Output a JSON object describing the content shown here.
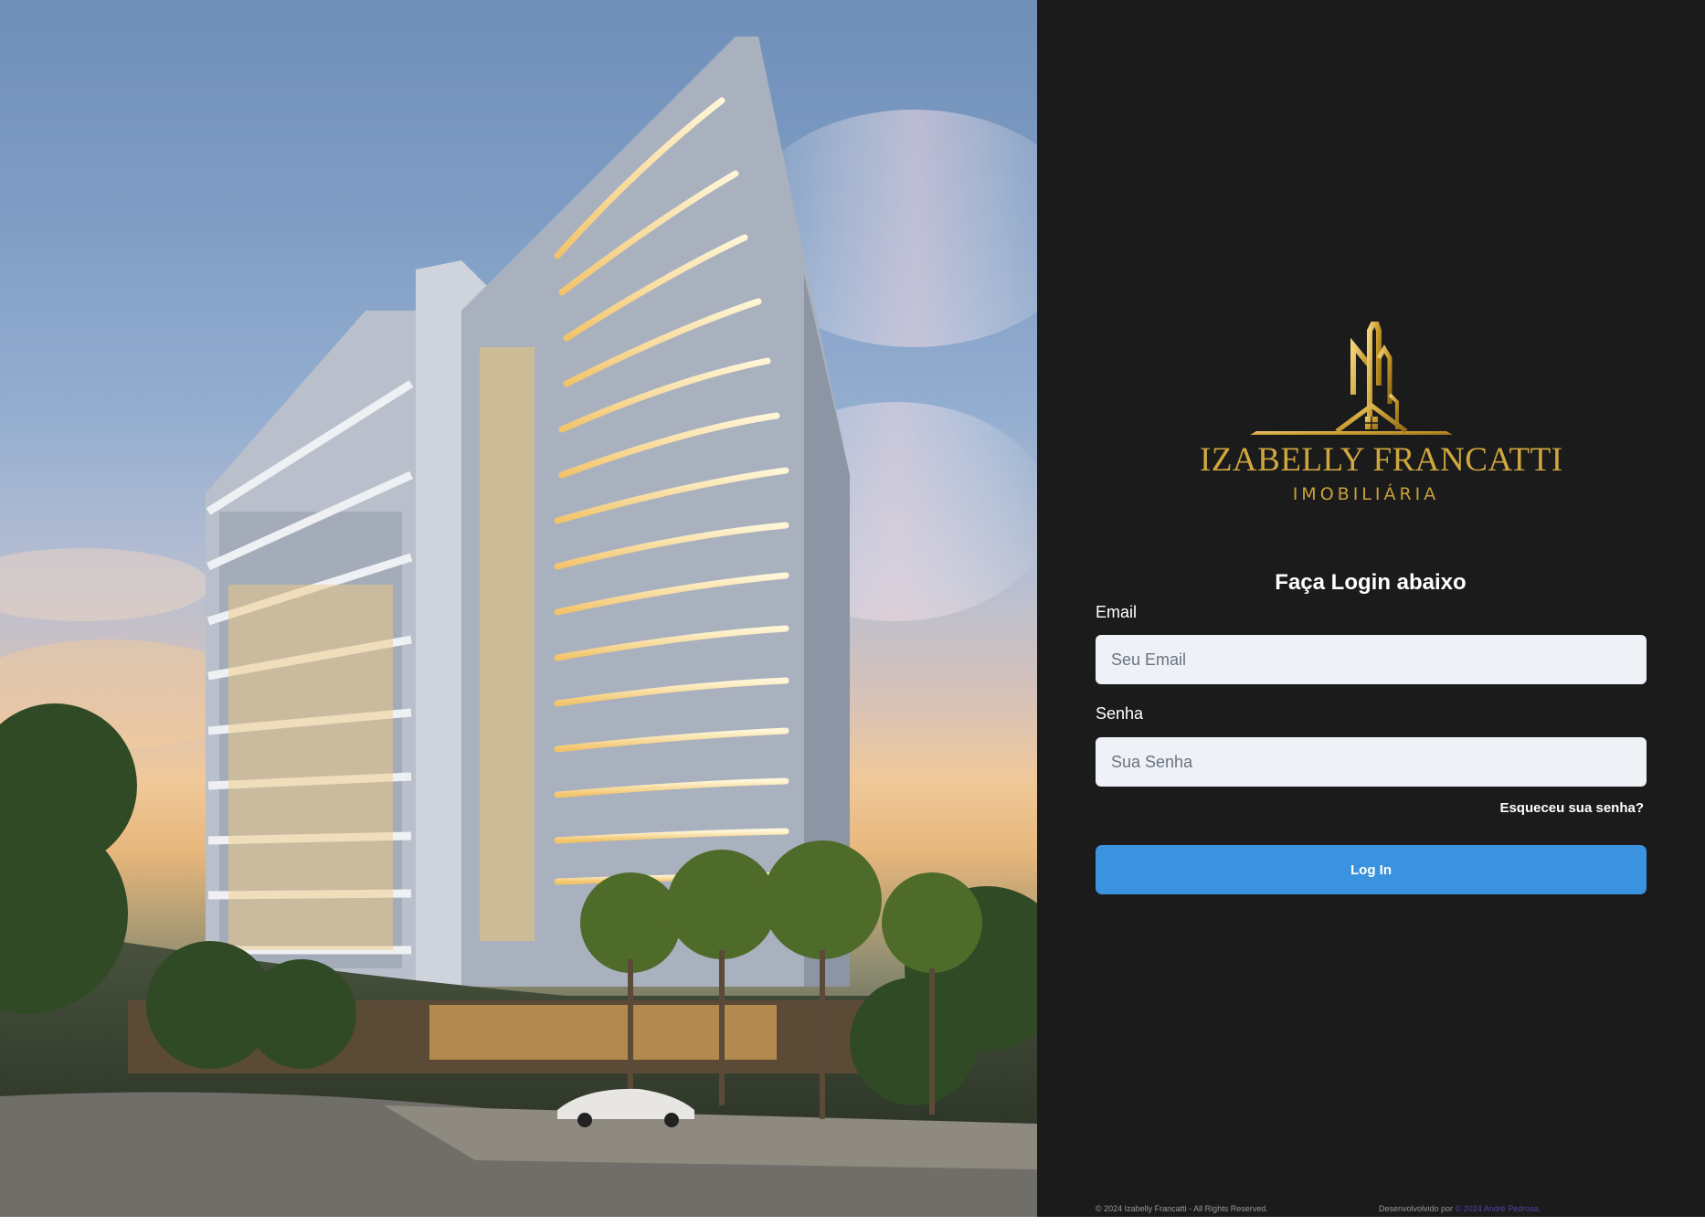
{
  "hero": {
    "description_icon": "building-rendering-image"
  },
  "brand": {
    "name": "IZABELLY FRANCATTI",
    "subtitle": "IMOBILIÁRIA",
    "gold": "#cfa73e"
  },
  "login": {
    "title": "Faça Login abaixo",
    "email_label": "Email",
    "email_placeholder": "Seu Email",
    "email_value": "",
    "password_label": "Senha",
    "password_placeholder": "Sua Senha",
    "password_value": "",
    "forgot_label": "Esqueceu sua senha?",
    "submit_label": "Log In",
    "accent": "#3b93df"
  },
  "footer": {
    "copyright": "© 2024 Izabelly Francatti - All Rights Reserved.",
    "dev_prefix": "Desenvolvolvido por",
    "dev_link": "© 2024 André Pedrosa."
  }
}
